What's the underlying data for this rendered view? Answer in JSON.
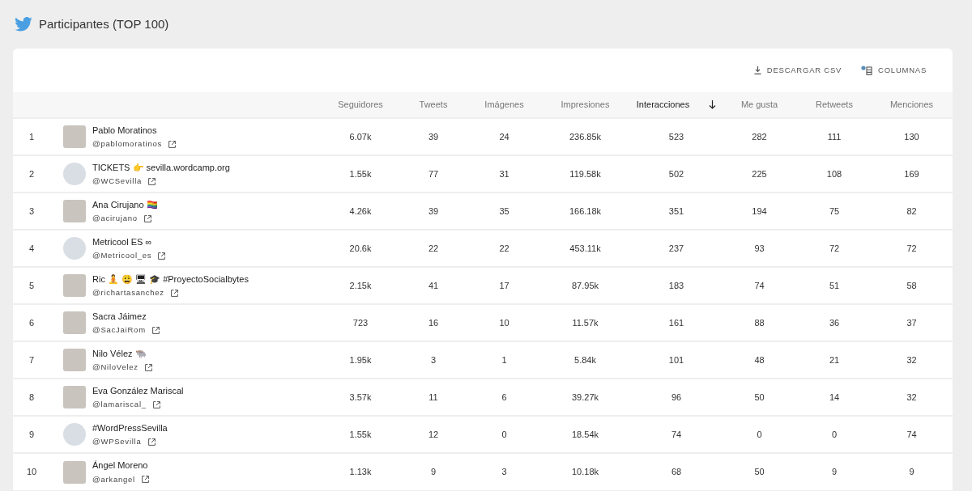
{
  "title": "Participantes (TOP 100)",
  "toolbar": [
    {
      "kind": "download",
      "label": "DESCARGAR CSV"
    },
    {
      "kind": "columns",
      "label": "COLUMNAS"
    }
  ],
  "columns": [
    {
      "label": "Seguidores",
      "sorted": false
    },
    {
      "label": "Tweets",
      "sorted": false
    },
    {
      "label": "Imágenes",
      "sorted": false
    },
    {
      "label": "Impresiones",
      "sorted": false
    },
    {
      "label": "Interacciones",
      "sorted": true
    },
    {
      "label": "Me gusta",
      "sorted": false
    },
    {
      "label": "Retweets",
      "sorted": false
    },
    {
      "label": "Menciones",
      "sorted": false
    }
  ],
  "rows": [
    {
      "rank": "1",
      "avatar": {
        "kind": "photo"
      },
      "name": "Pablo Moratinos",
      "handle": "@pablomoratinos",
      "values": [
        "6.07k",
        "39",
        "24",
        "236.85k",
        "523",
        "282",
        "111",
        "130"
      ]
    },
    {
      "rank": "2",
      "avatar": {
        "kind": "logo"
      },
      "name": "TICKETS 👉 sevilla.wordcamp.org",
      "handle": "@WCSevilla",
      "values": [
        "1.55k",
        "77",
        "31",
        "119.58k",
        "502",
        "225",
        "108",
        "169"
      ]
    },
    {
      "rank": "3",
      "avatar": {
        "kind": "photo"
      },
      "name": "Ana Cirujano 🏳️‍🌈",
      "handle": "@acirujano",
      "values": [
        "4.26k",
        "39",
        "35",
        "166.18k",
        "351",
        "194",
        "75",
        "82"
      ]
    },
    {
      "rank": "4",
      "avatar": {
        "kind": "logo"
      },
      "name": "Metricool ES ∞",
      "handle": "@Metricool_es",
      "values": [
        "20.6k",
        "22",
        "22",
        "453.11k",
        "237",
        "93",
        "72",
        "72"
      ]
    },
    {
      "rank": "5",
      "avatar": {
        "kind": "photo"
      },
      "name": "Ric 🧘 😩 🖥 🎓 #ProyectoSocialbytes",
      "handle": "@richartasanchez",
      "values": [
        "2.15k",
        "41",
        "17",
        "87.95k",
        "183",
        "74",
        "51",
        "58"
      ]
    },
    {
      "rank": "6",
      "avatar": {
        "kind": "photo"
      },
      "name": "Sacra Jáimez",
      "handle": "@SacJaiRom",
      "values": [
        "723",
        "16",
        "10",
        "11.57k",
        "161",
        "88",
        "36",
        "37"
      ]
    },
    {
      "rank": "7",
      "avatar": {
        "kind": "photo"
      },
      "name": "Nilo Vélez 🐃",
      "handle": "@NiloVelez",
      "values": [
        "1.95k",
        "3",
        "1",
        "5.84k",
        "101",
        "48",
        "21",
        "32"
      ]
    },
    {
      "rank": "8",
      "avatar": {
        "kind": "photo"
      },
      "name": "Eva González Mariscal",
      "handle": "@lamariscal_",
      "values": [
        "3.57k",
        "11",
        "6",
        "39.27k",
        "96",
        "50",
        "14",
        "32"
      ]
    },
    {
      "rank": "9",
      "avatar": {
        "kind": "logo"
      },
      "name": "#WordPressSevilla",
      "handle": "@WPSevilla",
      "values": [
        "1.55k",
        "12",
        "0",
        "18.54k",
        "74",
        "0",
        "0",
        "74"
      ]
    },
    {
      "rank": "10",
      "avatar": {
        "kind": "photo"
      },
      "name": "Ángel Moreno",
      "handle": "@arkangel",
      "values": [
        "1.13k",
        "9",
        "3",
        "10.18k",
        "68",
        "50",
        "9",
        "9"
      ]
    }
  ]
}
